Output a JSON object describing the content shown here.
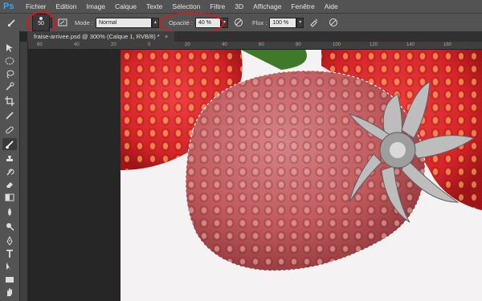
{
  "app": {
    "logo": "Ps"
  },
  "menu": [
    "Fichier",
    "Edition",
    "Image",
    "Calque",
    "Texte",
    "Sélection",
    "Filtre",
    "3D",
    "Affichage",
    "Fenêtre",
    "Aide"
  ],
  "options": {
    "brush_size": "50",
    "mode_label": "Mode :",
    "mode_value": "Normal",
    "opacity_label": "Opacité :",
    "opacity_value": "40 %",
    "flow_label": "Flux :",
    "flow_value": "100 %"
  },
  "document": {
    "tab_title": "fraise-arrivee.psd @ 300% (Calque 1, RVB/8) *",
    "close": "×"
  },
  "ruler": {
    "top": [
      "60",
      "40",
      "20",
      "0",
      "20",
      "40",
      "60",
      "80",
      "100",
      "120",
      "140",
      "160"
    ]
  },
  "tools": [
    "move-tool",
    "marquee-tool",
    "lasso-tool",
    "quick-select-tool",
    "crop-tool",
    "eyedropper-tool",
    "healing-tool",
    "brush-tool",
    "clone-stamp-tool",
    "history-brush-tool",
    "eraser-tool",
    "gradient-tool",
    "blur-tool",
    "dodge-tool",
    "pen-tool",
    "type-tool",
    "path-select-tool",
    "shape-tool",
    "hand-tool",
    "zoom-tool"
  ],
  "colors": {
    "highlight_circle": "#d7191c",
    "ps_blue": "#31a8ff",
    "strawberry_red": "#d6262a",
    "mask_tint": "#c25a5e"
  }
}
